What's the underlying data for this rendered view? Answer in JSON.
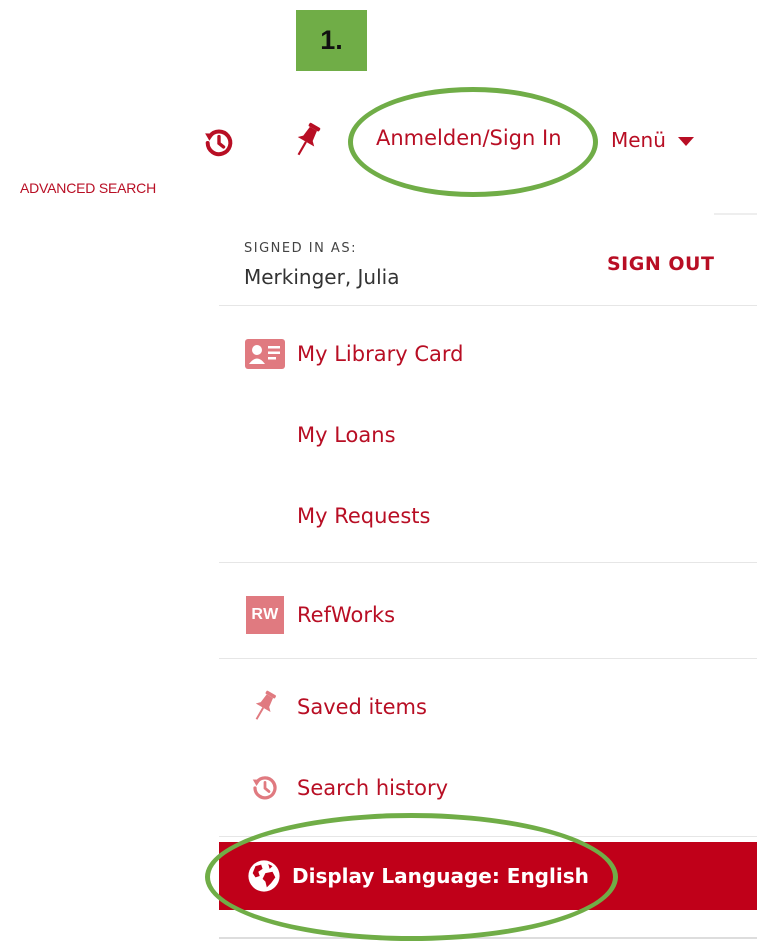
{
  "step_badge": "1.",
  "header": {
    "signin_label": "Anmelden/Sign In",
    "menu_label": "Menü",
    "advanced_search": "ADVANCED SEARCH"
  },
  "icons": {
    "history": "history-icon",
    "pin": "pin-icon",
    "library_card": "id-card-icon",
    "refworks": "refworks-icon",
    "globe": "globe-icon",
    "chevron": "caret-down-icon"
  },
  "account": {
    "signed_in_label": "SIGNED IN AS:",
    "user_name": "Merkinger, Julia",
    "sign_out_label": "SIGN OUT"
  },
  "menu": {
    "library_card": "My Library Card",
    "loans": "My Loans",
    "requests": "My Requests",
    "refworks": "RefWorks",
    "refworks_badge": "RW",
    "saved_items": "Saved items",
    "search_history": "Search history",
    "display_language": "Display Language: English"
  },
  "colors": {
    "accent": "#b80e24",
    "language_bar": "#c00019",
    "highlight": "#70ad47",
    "icon_muted": "#e07a80"
  }
}
